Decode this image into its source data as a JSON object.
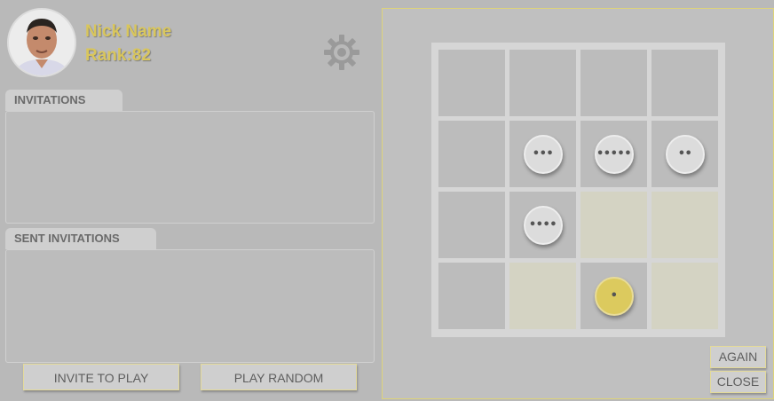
{
  "profile": {
    "name": "Nick Name",
    "rank": "Rank:82"
  },
  "icons": {
    "settings": "gear-icon",
    "avatar": "user-photo"
  },
  "colors": {
    "accent_yellow": "#d9c65c",
    "background": "#b9b9b9"
  },
  "invitations": {
    "tab_label": "INVITATIONS",
    "items": []
  },
  "sent_invitations": {
    "tab_label": "SENT INVITATIONS",
    "items": []
  },
  "actions": {
    "invite_label": "INVITE TO PLAY",
    "random_label": "PLAY RANDOM",
    "again_label": "AGAIN",
    "close_label": "CLOSE"
  },
  "board": {
    "rows": 4,
    "cols": 4,
    "highlighted_cells": [
      [
        2,
        2
      ],
      [
        2,
        3
      ],
      [
        3,
        1
      ],
      [
        3,
        3
      ]
    ],
    "pieces": [
      {
        "row": 1,
        "col": 1,
        "label": "•••",
        "color": "gray"
      },
      {
        "row": 1,
        "col": 2,
        "label": "•••••",
        "color": "gray"
      },
      {
        "row": 1,
        "col": 3,
        "label": "••",
        "color": "gray"
      },
      {
        "row": 2,
        "col": 1,
        "label": "••••",
        "color": "gray"
      },
      {
        "row": 3,
        "col": 2,
        "label": "•",
        "color": "yellow"
      }
    ]
  }
}
